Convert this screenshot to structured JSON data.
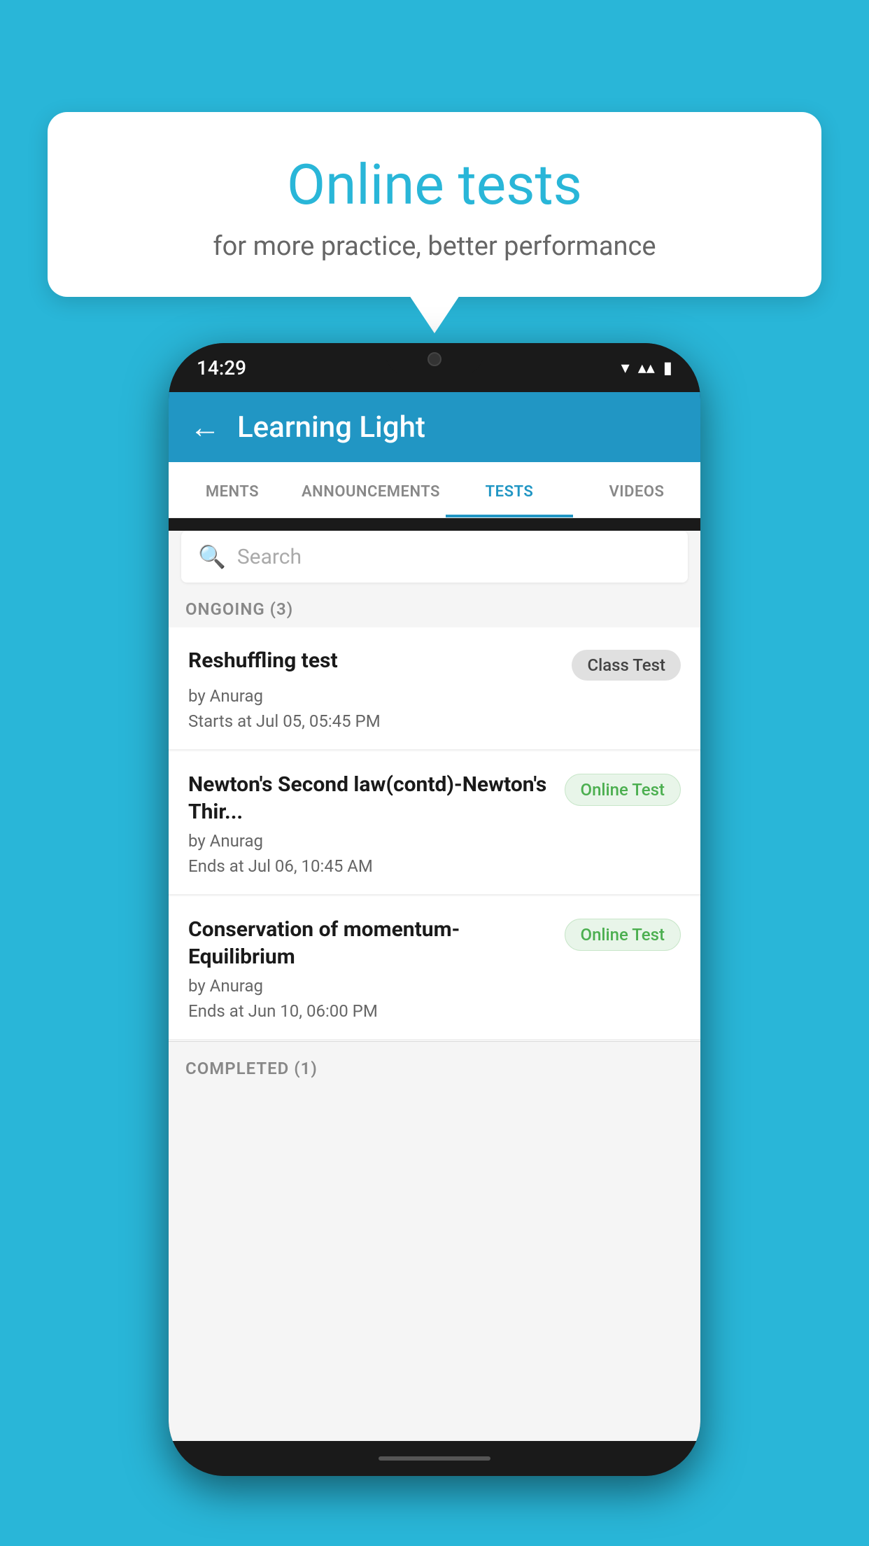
{
  "background_color": "#29b6d8",
  "bubble": {
    "title": "Online tests",
    "subtitle": "for more practice, better performance"
  },
  "phone": {
    "status_bar": {
      "time": "14:29",
      "wifi_icon": "▼",
      "signal_icon": "▲",
      "battery_icon": "▮"
    },
    "app_bar": {
      "back_label": "←",
      "title": "Learning Light"
    },
    "tabs": [
      {
        "label": "MENTS",
        "active": false
      },
      {
        "label": "ANNOUNCEMENTS",
        "active": false
      },
      {
        "label": "TESTS",
        "active": true
      },
      {
        "label": "VIDEOS",
        "active": false
      }
    ],
    "search": {
      "placeholder": "Search"
    },
    "ongoing_section": {
      "header": "ONGOING (3)",
      "tests": [
        {
          "name": "Reshuffling test",
          "badge": "Class Test",
          "badge_type": "class",
          "by": "by Anurag",
          "date": "Starts at  Jul 05, 05:45 PM"
        },
        {
          "name": "Newton's Second law(contd)-Newton's Thir...",
          "badge": "Online Test",
          "badge_type": "online",
          "by": "by Anurag",
          "date": "Ends at  Jul 06, 10:45 AM"
        },
        {
          "name": "Conservation of momentum-Equilibrium",
          "badge": "Online Test",
          "badge_type": "online",
          "by": "by Anurag",
          "date": "Ends at  Jun 10, 06:00 PM"
        }
      ]
    },
    "completed_section": {
      "header": "COMPLETED (1)"
    }
  }
}
